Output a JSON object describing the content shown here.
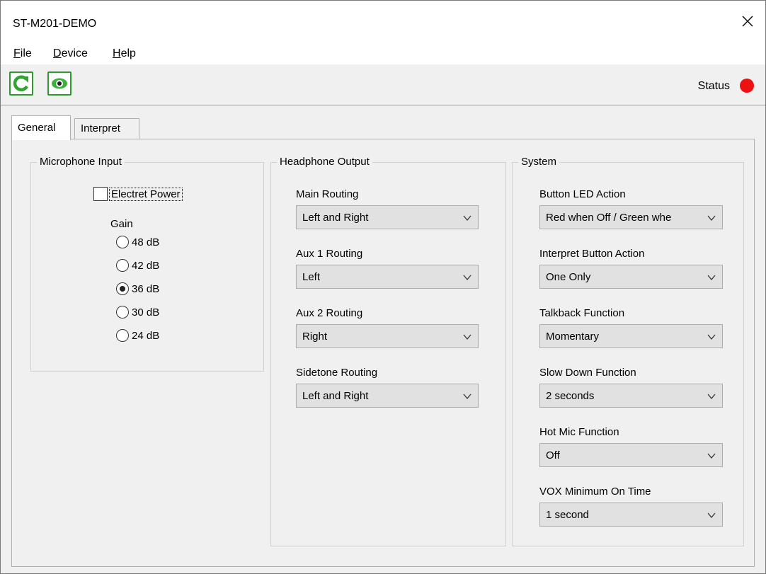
{
  "window": {
    "title": "ST-M201-DEMO"
  },
  "menu": [
    {
      "label": "File",
      "accel": "F",
      "rest": "ile"
    },
    {
      "label": "Device",
      "accel": "D",
      "rest": "evice"
    },
    {
      "label": "Help",
      "accel": "H",
      "rest": "elp"
    }
  ],
  "toolbar": {
    "buttons": [
      {
        "icon": "refresh-icon"
      },
      {
        "icon": "eye-icon"
      }
    ],
    "status_label": "Status",
    "status_color": "#ee1111"
  },
  "tabs": [
    {
      "label": "General",
      "active": true
    },
    {
      "label": "Interpret",
      "active": false
    }
  ],
  "microphone": {
    "title": "Microphone Input",
    "electret_label": "Electret Power",
    "electret_checked": false,
    "gain_label": "Gain",
    "gain_options": [
      "48 dB",
      "42 dB",
      "36 dB",
      "30 dB",
      "24 dB"
    ],
    "gain_selected": "36 dB"
  },
  "headphone": {
    "title": "Headphone Output",
    "fields": [
      {
        "label": "Main Routing",
        "value": "Left and Right"
      },
      {
        "label": "Aux 1 Routing",
        "value": "Left"
      },
      {
        "label": "Aux 2 Routing",
        "value": "Right"
      },
      {
        "label": "Sidetone Routing",
        "value": "Left and Right"
      }
    ]
  },
  "system": {
    "title": "System",
    "fields": [
      {
        "label": "Button LED Action",
        "value": "Red when Off / Green whe"
      },
      {
        "label": "Interpret Button Action",
        "value": "One Only"
      },
      {
        "label": "Talkback Function",
        "value": "Momentary"
      },
      {
        "label": "Slow Down Function",
        "value": "2 seconds"
      },
      {
        "label": "Hot Mic Function",
        "value": "Off"
      },
      {
        "label": "VOX Minimum On Time",
        "value": "1 second"
      }
    ]
  }
}
